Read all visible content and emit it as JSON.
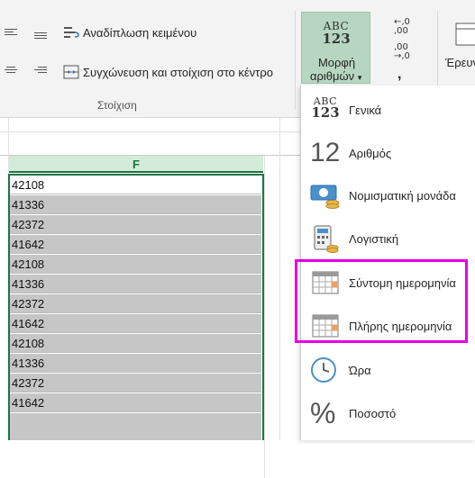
{
  "ribbon": {
    "wrap_text": "Αναδίπλωση κειμένου",
    "merge_center": "Συγχώνευση και στοίχιση στο κέντρο",
    "alignment_group": "Στοίχιση",
    "number_format": {
      "icon_text_top": "ABC",
      "icon_text_bottom": "123",
      "label_line1": "Μορφή",
      "label_line2": "αριθμών"
    },
    "comma_style": ",",
    "cut_off_label": "Έρευν"
  },
  "sheet": {
    "column_header": "F",
    "cells": [
      "42108",
      "41336",
      "42372",
      "41642",
      "42108",
      "41336",
      "42372",
      "41642",
      "42108",
      "41336",
      "42372",
      "41642"
    ]
  },
  "menu": {
    "items": [
      {
        "label": "Γενικά",
        "icon": "abc-123-icon"
      },
      {
        "label": "Αριθμός",
        "icon": "number-12-icon"
      },
      {
        "label": "Νομισματική μονάδα",
        "icon": "currency-icon"
      },
      {
        "label": "Λογιστική",
        "icon": "accounting-calculator-icon"
      },
      {
        "label": "Σύντομη ημερομηνία",
        "icon": "calendar-icon"
      },
      {
        "label": "Πλήρης ημερομηνία",
        "icon": "calendar-icon"
      },
      {
        "label": "Ώρα",
        "icon": "clock-icon"
      },
      {
        "label": "Ποσοστό",
        "icon": "percent-icon"
      }
    ],
    "icon_text": {
      "abc": "ABC",
      "n123": "123",
      "n12": "12",
      "percent": "%"
    }
  },
  "colors": {
    "accent_green": "#217346",
    "highlight_magenta": "#e600e6",
    "selected_button": "#b7d6c1"
  }
}
